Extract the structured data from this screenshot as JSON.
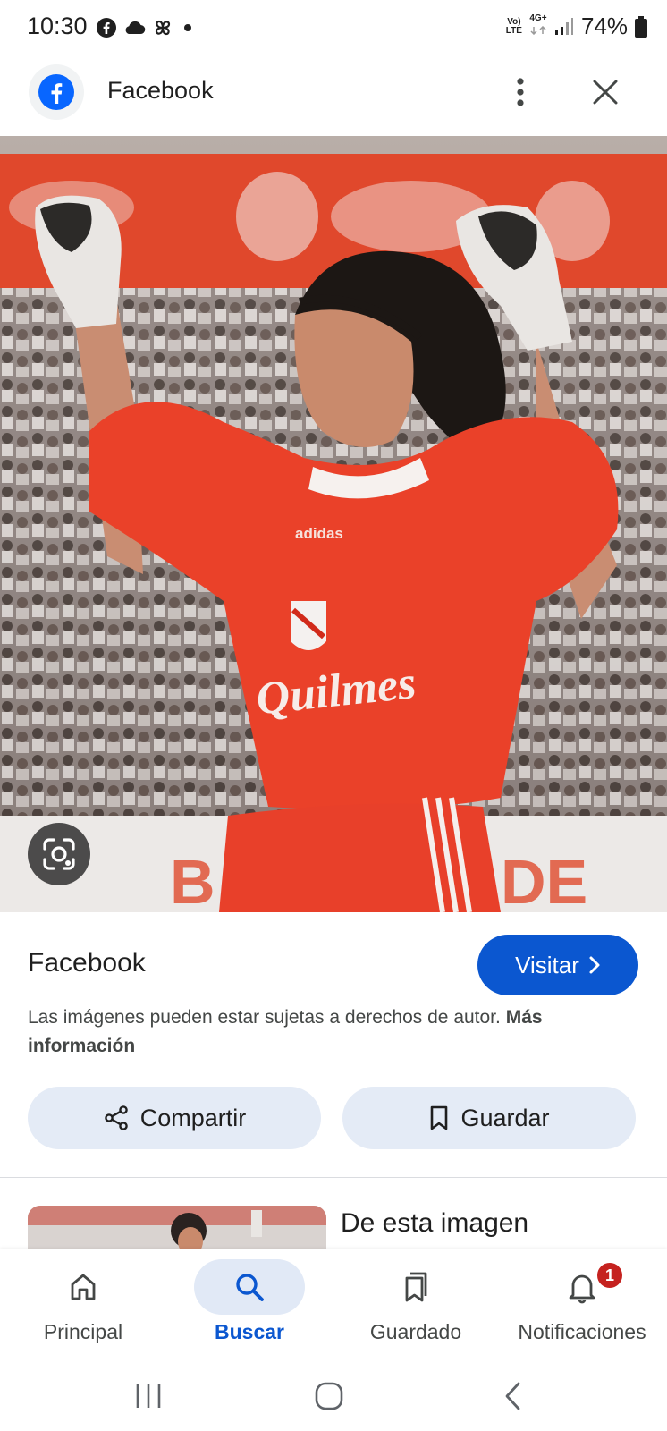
{
  "status_bar": {
    "time": "10:30",
    "left_icons": [
      "facebook-icon",
      "cloud-icon",
      "pinwheel-icon",
      "dot-icon"
    ],
    "network_top": "Vo)",
    "network_bottom": "LTE",
    "network_type": "4G+",
    "battery": "74%"
  },
  "top_bar": {
    "site_title": "Facebook",
    "icons": [
      "facebook-logo-icon",
      "more-vertical-icon",
      "close-icon"
    ]
  },
  "image": {
    "jersey_text": "Quilmes",
    "brand_text": "adidas",
    "lens_icon": "google-lens-icon"
  },
  "info": {
    "source_name": "Facebook",
    "visit_label": "Visitar",
    "copyright_text": "Las imágenes pueden estar sujetas a derechos de autor.",
    "more_info_label": "Más información"
  },
  "actions": {
    "share_label": "Compartir",
    "save_label": "Guardar"
  },
  "related": {
    "section_title": "De esta imagen"
  },
  "bottom_nav": {
    "items": [
      {
        "label": "Principal",
        "icon": "home-icon",
        "active": false
      },
      {
        "label": "Buscar",
        "icon": "search-icon",
        "active": true
      },
      {
        "label": "Guardado",
        "icon": "bookmarks-icon",
        "active": false
      },
      {
        "label": "Notificaciones",
        "icon": "bell-icon",
        "active": false,
        "badge": "1"
      }
    ]
  },
  "colors": {
    "accent": "#0b57d0",
    "action_bg": "#e4ebf6",
    "badge": "#c5221f"
  }
}
